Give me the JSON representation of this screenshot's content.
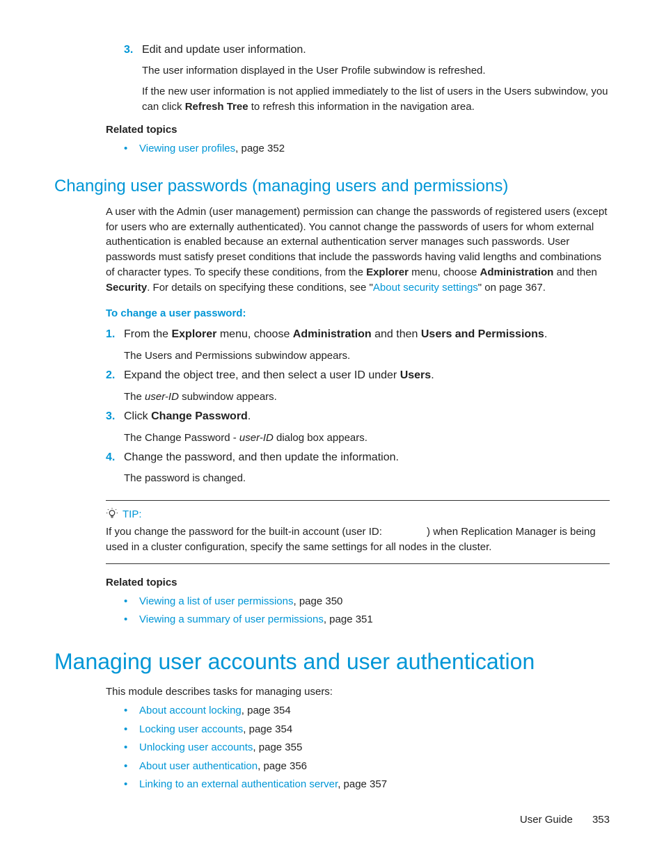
{
  "top_list": {
    "item3": {
      "num": "3.",
      "line1": "Edit and update user information.",
      "line2": "The user information displayed in the User Profile subwindow is refreshed.",
      "line3_a": "If the new user information is not applied immediately to the list of users in the Users subwindow, you can click ",
      "line3_b": "Refresh Tree",
      "line3_c": " to refresh this information in the navigation area."
    }
  },
  "related1": {
    "heading": "Related topics",
    "item1_link": "Viewing user profiles",
    "item1_suffix": ", page 352"
  },
  "section1": {
    "heading": "Changing user passwords (managing users and permissions)",
    "para_a": "A user with the Admin (user management) permission can change the passwords of registered users (except for users who are externally authenticated). You cannot change the passwords of users for whom external authentication is enabled because an external authentication server manages such passwords. User passwords must satisfy preset conditions that include the passwords having valid lengths and combinations of character types. To specify these conditions, from the ",
    "para_b": "Explorer",
    "para_c": " menu, choose ",
    "para_d": "Administration",
    "para_e": " and then ",
    "para_f": "Security",
    "para_g": ". For details on specifying these conditions, see \"",
    "para_h": "About security settings",
    "para_i": "\" on page 367.",
    "subhead": "To change a user password:",
    "step1": {
      "num": "1.",
      "a": "From the ",
      "b": "Explorer",
      "c": " menu, choose ",
      "d": "Administration",
      "e": " and then ",
      "f": "Users and Permissions",
      "g": ".",
      "sub": "The Users and Permissions subwindow appears."
    },
    "step2": {
      "num": "2.",
      "a": "Expand the object tree, and then select a user ID under ",
      "b": "Users",
      "c": ".",
      "sub_a": "The ",
      "sub_b": "user-ID",
      "sub_c": " subwindow appears."
    },
    "step3": {
      "num": "3.",
      "a": "Click ",
      "b": "Change Password",
      "c": ".",
      "sub_a": "The Change Password - ",
      "sub_b": "user-ID",
      "sub_c": " dialog box appears."
    },
    "step4": {
      "num": "4.",
      "a": "Change the password, and then update the information.",
      "sub": "The password is changed."
    }
  },
  "tip": {
    "label": "TIP:",
    "text_a": "If you change the password for the built-in account (user ID: ",
    "text_b": ") when Replication Manager is being used in a cluster configuration, specify the same settings for all nodes in the cluster."
  },
  "related2": {
    "heading": "Related topics",
    "item1_link": "Viewing a list of user permissions",
    "item1_suffix": ", page 350",
    "item2_link": "Viewing a summary of user permissions",
    "item2_suffix": ", page 351"
  },
  "section2": {
    "heading": "Managing user accounts and user authentication",
    "intro": "This module describes tasks for managing users:",
    "items": [
      {
        "link": "About account locking",
        "suffix": ", page 354"
      },
      {
        "link": "Locking user accounts",
        "suffix": ", page 354"
      },
      {
        "link": "Unlocking user accounts",
        "suffix": ", page 355"
      },
      {
        "link": "About user authentication",
        "suffix": ", page 356"
      },
      {
        "link": "Linking to an external authentication server",
        "suffix": ", page 357"
      }
    ]
  },
  "footer": {
    "label": "User Guide",
    "page": "353"
  }
}
